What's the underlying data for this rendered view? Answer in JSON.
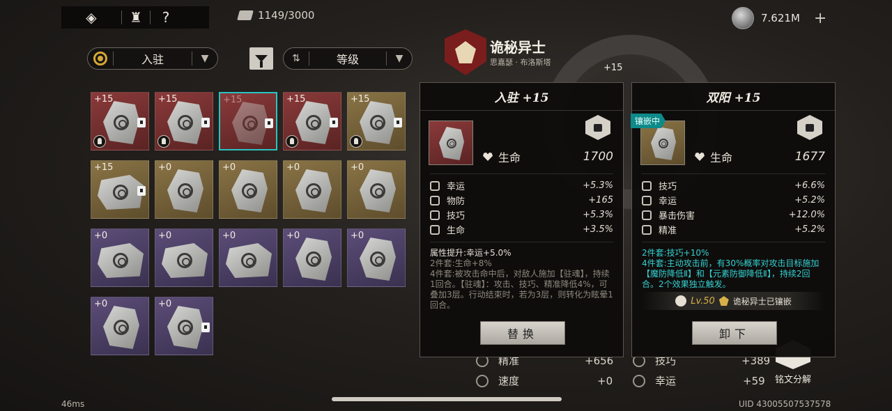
{
  "topbar": {
    "capacity": "1149/3000",
    "currency": "7.621M",
    "help_label": "?"
  },
  "filters": {
    "slot_label": "入驻",
    "sort_label": "等级"
  },
  "grid": [
    {
      "level": "+15",
      "color": "red",
      "locked": true,
      "helm": true
    },
    {
      "level": "+15",
      "color": "red",
      "locked": true,
      "helm": true
    },
    {
      "level": "+15",
      "color": "red",
      "locked": true,
      "helm": false,
      "selected": true
    },
    {
      "level": "+15",
      "color": "red",
      "locked": true,
      "helm": true
    },
    {
      "level": "+15",
      "color": "gold",
      "locked": true,
      "helm": true
    },
    {
      "level": "+15",
      "color": "gold",
      "locked": true,
      "helm": false
    },
    {
      "level": "+0",
      "color": "gold",
      "locked": false,
      "helm": false
    },
    {
      "level": "+0",
      "color": "gold",
      "locked": false,
      "helm": false
    },
    {
      "level": "+0",
      "color": "gold",
      "locked": false,
      "helm": false
    },
    {
      "level": "+0",
      "color": "gold",
      "locked": false,
      "helm": false
    },
    {
      "level": "+0",
      "color": "purple",
      "locked": false,
      "helm": false
    },
    {
      "level": "+0",
      "color": "purple",
      "locked": false,
      "helm": false
    },
    {
      "level": "+0",
      "color": "purple",
      "locked": false,
      "helm": false
    },
    {
      "level": "+0",
      "color": "purple",
      "locked": false,
      "helm": false
    },
    {
      "level": "+0",
      "color": "purple",
      "locked": false,
      "helm": false
    },
    {
      "level": "+0",
      "color": "purple",
      "locked": false,
      "helm": false
    },
    {
      "level": "+0",
      "color": "purple",
      "locked": true,
      "helm": false
    }
  ],
  "character": {
    "name": "诡秘异士",
    "subtitle": "思嘉瑟 · 布洛斯塔",
    "wheel_level": "+15"
  },
  "left_panel": {
    "title": "入驻 +15",
    "main_stat_label": "生命",
    "main_stat_value": "1700",
    "substats": [
      {
        "label": "幸运",
        "value": "+5.3%"
      },
      {
        "label": "物防",
        "value": "+165"
      },
      {
        "label": "技巧",
        "value": "+5.3%"
      },
      {
        "label": "生命",
        "value": "+3.5%"
      }
    ],
    "desc_highlight": "属性提升:幸运+5.0%",
    "desc_set2": "2件套:生命+8%",
    "desc_set4": "4件套:被攻击命中后，对敌人施加【驻魂】，持续1回合。【驻魂】：攻击、技巧、精准降低4%，可叠加3层。行动结束时，若为3层，则转化为眩晕1回合。",
    "button_label": "替换"
  },
  "right_panel": {
    "title": "双阳 +15",
    "badge": "镶嵌中",
    "main_stat_label": "生命",
    "main_stat_value": "1677",
    "substats": [
      {
        "label": "技巧",
        "value": "+6.6%"
      },
      {
        "label": "幸运",
        "value": "+5.2%"
      },
      {
        "label": "暴击伤害",
        "value": "+12.0%"
      },
      {
        "label": "精准",
        "value": "+5.2%"
      }
    ],
    "desc_set2": "2件套:技巧+10%",
    "desc_set4": "4件套:主动攻击前，有30%概率对攻击目标施加【魔防降低Ⅱ】和【元素防御降低Ⅱ】，持续2回合。2个效果独立触发。",
    "equipped_level": "Lv.50",
    "equipped_text": "诡秘异士已镶嵌",
    "button_label": "卸下"
  },
  "background_stats": {
    "left": [
      {
        "label": "精准",
        "value": "+656"
      },
      {
        "label": "速度",
        "value": "+0"
      }
    ],
    "right": [
      {
        "label": "技巧",
        "value": "+389"
      },
      {
        "label": "幸运",
        "value": "+59"
      }
    ],
    "decompose_label": "铭文分解"
  },
  "footer": {
    "latency": "46ms",
    "uid": "UID 43005507537578"
  }
}
